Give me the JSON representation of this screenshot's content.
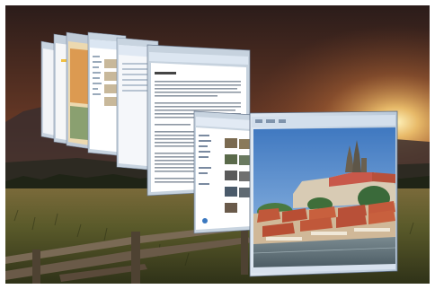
{
  "screen": {
    "description_type": "flip3d-window-switcher",
    "wallpaper": "sunset-field-with-wooden-fence",
    "windows": [
      {
        "order": 1,
        "kind": "document-window",
        "state": "background"
      },
      {
        "order": 2,
        "kind": "document-window",
        "state": "background"
      },
      {
        "order": 3,
        "kind": "document-window",
        "state": "background"
      },
      {
        "order": 4,
        "kind": "explorer-window",
        "state": "background"
      },
      {
        "order": 5,
        "kind": "word-processor-window",
        "state": "background"
      },
      {
        "order": 6,
        "kind": "word-processor-document",
        "state": "background"
      },
      {
        "order": 7,
        "kind": "photo-gallery-window",
        "state": "background"
      },
      {
        "order": 8,
        "kind": "image-viewer-window",
        "state": "foreground",
        "content": "photo-of-castle-and-river-city"
      }
    ]
  },
  "colors": {
    "sky_top": "#3a2620",
    "sunset": "#f0c070",
    "field": "#6a6a30",
    "window_frame": "#c8d4e0",
    "photo_sky": "#5d8fc8",
    "roofs": "#c0583a"
  }
}
